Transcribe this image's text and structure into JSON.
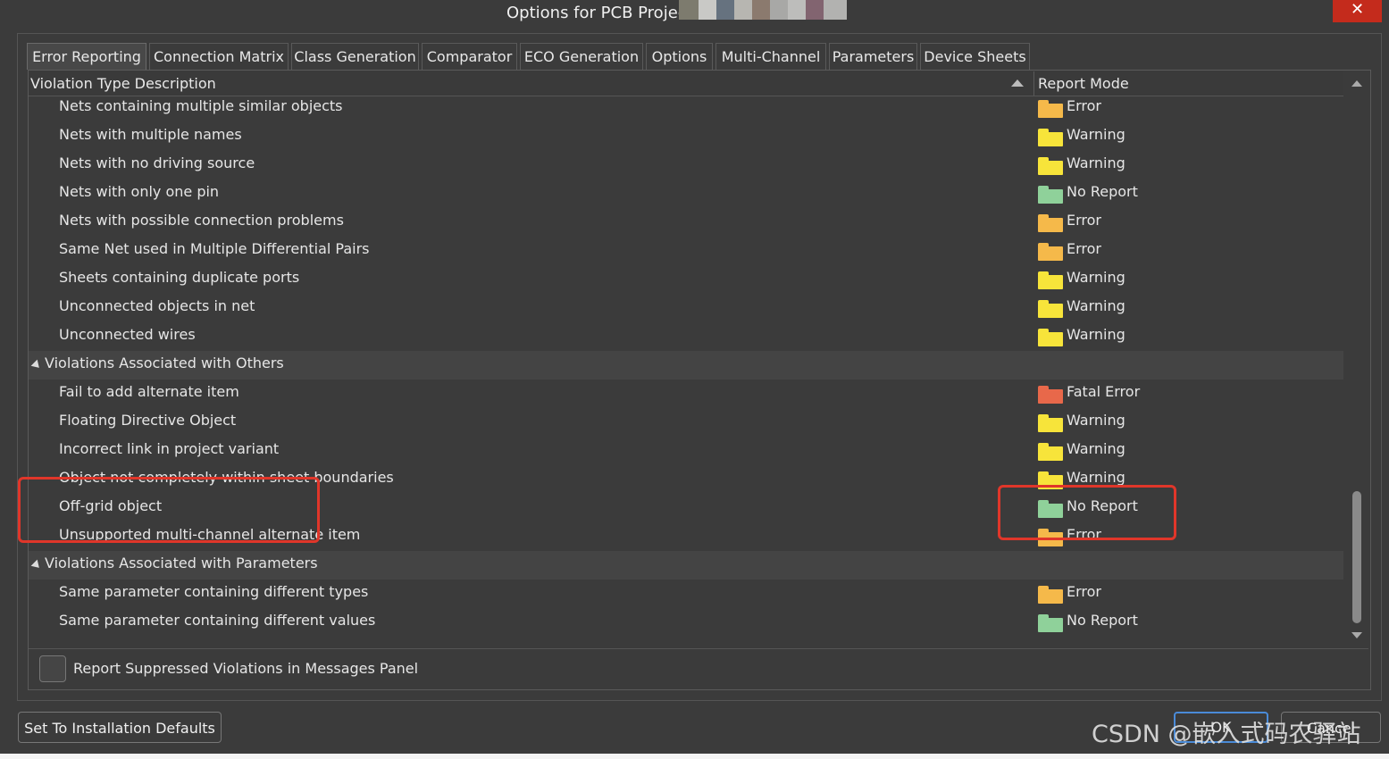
{
  "window": {
    "title": "Options for PCB Projec",
    "close_glyph": "✕"
  },
  "tabs": [
    "Error Reporting",
    "Connection Matrix",
    "Class Generation",
    "Comparator",
    "ECO Generation",
    "Options",
    "Multi-Channel",
    "Parameters",
    "Device Sheets"
  ],
  "active_tab": "Error Reporting",
  "grid": {
    "columns": {
      "description": "Violation Type Description",
      "mode": "Report Mode"
    },
    "rows": [
      {
        "type": "item",
        "label": "Nets containing multiple similar objects",
        "mode": "Error"
      },
      {
        "type": "item",
        "label": "Nets with multiple names",
        "mode": "Warning"
      },
      {
        "type": "item",
        "label": "Nets with no driving source",
        "mode": "Warning"
      },
      {
        "type": "item",
        "label": "Nets with only one pin",
        "mode": "No Report"
      },
      {
        "type": "item",
        "label": "Nets with possible connection problems",
        "mode": "Error"
      },
      {
        "type": "item",
        "label": "Same Net used in Multiple Differential Pairs",
        "mode": "Error"
      },
      {
        "type": "item",
        "label": "Sheets containing duplicate ports",
        "mode": "Warning"
      },
      {
        "type": "item",
        "label": "Unconnected objects in net",
        "mode": "Warning"
      },
      {
        "type": "item",
        "label": "Unconnected wires",
        "mode": "Warning"
      },
      {
        "type": "group",
        "label": "Violations Associated with Others"
      },
      {
        "type": "item",
        "label": "Fail to add alternate item",
        "mode": "Fatal Error"
      },
      {
        "type": "item",
        "label": "Floating Directive Object",
        "mode": "Warning"
      },
      {
        "type": "item",
        "label": "Incorrect link in project variant",
        "mode": "Warning"
      },
      {
        "type": "item",
        "label": "Object not completely within sheet boundaries",
        "mode": "Warning"
      },
      {
        "type": "item",
        "label": "Off-grid object",
        "mode": "No Report"
      },
      {
        "type": "item",
        "label": "Unsupported multi-channel alternate item",
        "mode": "Error"
      },
      {
        "type": "group",
        "label": "Violations Associated with Parameters"
      },
      {
        "type": "item",
        "label": "Same parameter containing different types",
        "mode": "Error"
      },
      {
        "type": "item",
        "label": "Same parameter containing different values",
        "mode": "No Report"
      }
    ]
  },
  "mode_colors": {
    "Error": "#f5b94a",
    "Warning": "#f7e43a",
    "No Report": "#8fd19a",
    "Fatal Error": "#e8684a"
  },
  "checkbox": {
    "label": "Report Suppressed Violations in Messages Panel",
    "checked": false
  },
  "buttons": {
    "defaults": "Set To Installation Defaults",
    "ok": "OK",
    "cancel": "Cancel"
  },
  "watermark": "CSDN @嵌入式码农驿站",
  "highlight_color": "#e0362a"
}
